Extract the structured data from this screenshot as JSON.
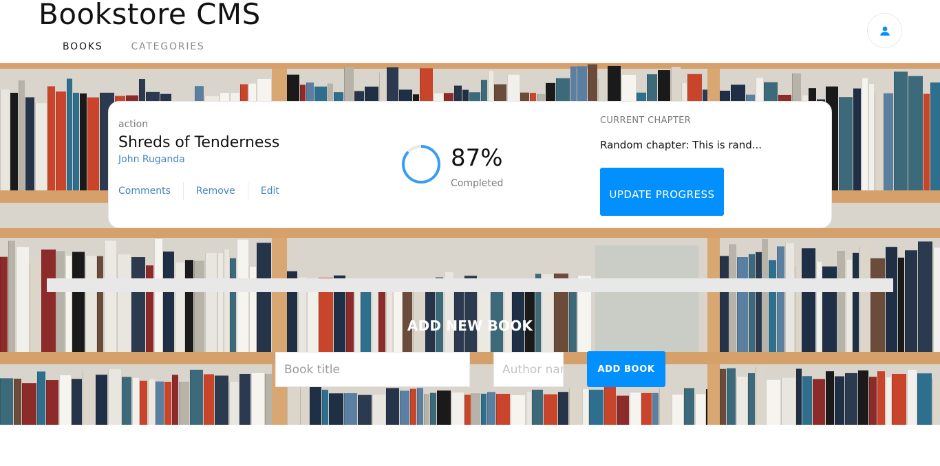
{
  "app": {
    "title": "Bookstore CMS",
    "accent_color": "#0290ff",
    "link_color": "#4386bf"
  },
  "nav": {
    "items": [
      {
        "label": "BOOKS",
        "active": true
      },
      {
        "label": "CATEGORIES",
        "active": false
      }
    ]
  },
  "user": {
    "icon": "user-icon"
  },
  "book": {
    "genre": "action",
    "title": "Shreds of Tenderness",
    "author": "John Ruganda",
    "actions": {
      "comments": "Comments",
      "remove": "Remove",
      "edit": "Edit"
    },
    "progress": {
      "percent_value": 87,
      "percent_label": "87%",
      "status": "Completed"
    },
    "chapter": {
      "label": "CURRENT CHAPTER",
      "value": "Random chapter: This is rand...",
      "button": "UPDATE PROGRESS"
    }
  },
  "add_book": {
    "heading": "ADD NEW BOOK",
    "title_placeholder": "Book title",
    "author_placeholder": "Author name",
    "button": "ADD BOOK"
  }
}
